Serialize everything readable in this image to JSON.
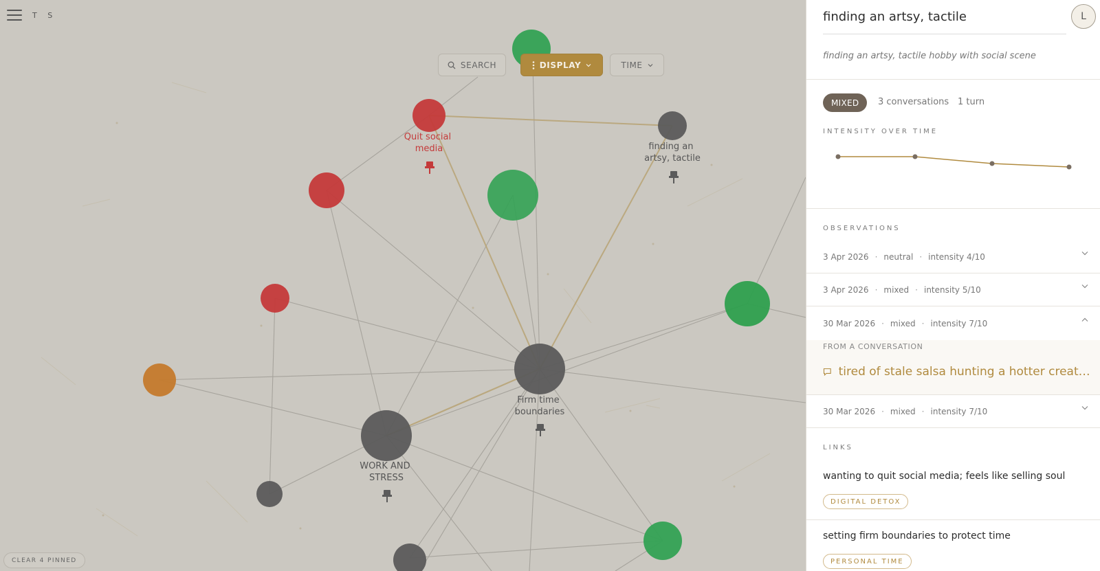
{
  "app": {
    "initials": "T S"
  },
  "toolbar": {
    "search_label": "SEARCH",
    "display_label": "DISPLAY",
    "time_label": "TIME"
  },
  "clear_pinned_label": "CLEAR 4 PINNED",
  "colors": {
    "canvas": "#cbc8c1",
    "node_red": "#c43a3a",
    "node_green": "#33a254",
    "node_gray": "#5b5b5b",
    "node_orange": "#c47a2c",
    "accent_gold": "#b08a3e",
    "badge_brown": "#6f6357"
  },
  "graph": {
    "labels": {
      "quit_social_media": [
        "Quit social",
        "media"
      ],
      "finding_artsy": [
        "finding an",
        "artsy, tactile"
      ],
      "firm_time": [
        "Firm time",
        "boundaries"
      ],
      "work_stress": [
        "WORK AND",
        "STRESS"
      ]
    }
  },
  "panel": {
    "title": "finding an artsy, tactile",
    "avatar_initial": "L",
    "subtitle": "finding an artsy, tactile hobby with social scene",
    "badge": "MIXED",
    "conversations": "3 conversations",
    "turns": "1 turn",
    "intensity_label": "INTENSITY OVER TIME",
    "intensity_series": [
      8,
      8,
      6,
      5
    ],
    "observations_label": "OBSERVATIONS",
    "observations": [
      {
        "date": "3 Apr 2026",
        "tone": "neutral",
        "intensity": "intensity 4/10",
        "expanded": false
      },
      {
        "date": "3 Apr 2026",
        "tone": "mixed",
        "intensity": "intensity 5/10",
        "expanded": false
      },
      {
        "date": "30 Mar 2026",
        "tone": "mixed",
        "intensity": "intensity 7/10",
        "expanded": true
      },
      {
        "date": "30 Mar 2026",
        "tone": "mixed",
        "intensity": "intensity 7/10",
        "expanded": false
      }
    ],
    "from_conversation_label": "FROM A CONVERSATION",
    "conversation_link": "tired of stale salsa hunting a hotter creativ...",
    "links_label": "LINKS",
    "links": [
      {
        "title": "wanting to quit social media; feels like selling soul",
        "tag": "DIGITAL DETOX"
      },
      {
        "title": "setting firm boundaries to protect time",
        "tag": "PERSONAL TIME"
      }
    ]
  }
}
